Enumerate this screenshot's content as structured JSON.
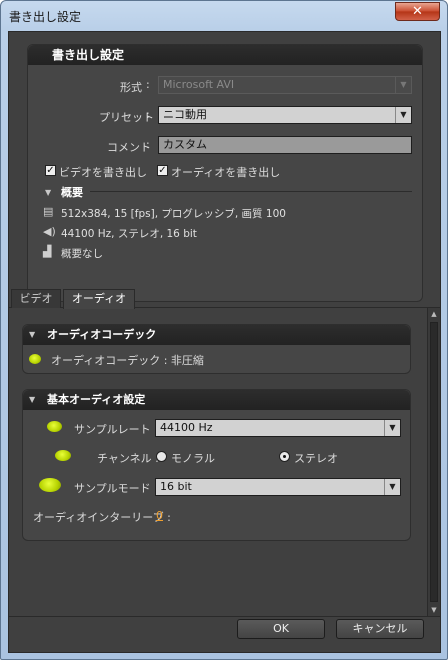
{
  "window": {
    "title": "書き出し設定",
    "close_glyph": "✕"
  },
  "export": {
    "section_title": "書き出し設定",
    "format_label": "形式",
    "format_value": "Microsoft AVI",
    "preset_label": "プリセット",
    "preset_value": "ニコ動用",
    "comment_label": "コメント",
    "comment_value": "カスタム",
    "export_video_label": "ビデオを書き出し",
    "export_audio_label": "オーディオを書き出し",
    "summary_title": "概要",
    "summary_video": "512x384, 15 [fps], プログレッシブ, 画質 100",
    "summary_audio": "44100 Hz, ステレオ, 16 bit",
    "summary_none": "概要なし"
  },
  "tabs": [
    {
      "label": "ビデオ"
    },
    {
      "label": "オーディオ"
    }
  ],
  "audio": {
    "codec_section_title": "オーディオコーデック",
    "codec_text": "オーディオコーデック : 非圧縮",
    "basic_section_title": "基本オーディオ設定",
    "sample_rate_label": "サンプルレート :",
    "sample_rate_value": "44100 Hz",
    "channels_label": "チャンネル :",
    "mono_label": "モノラル",
    "stereo_label": "ステレオ",
    "channel_selected": "ステレオ",
    "sample_mode_label": "サンプルモード :",
    "sample_mode_value": "16 bit",
    "interleave_label": "オーディオインターリーブ :",
    "interleave_value": "0"
  },
  "buttons": {
    "ok": "OK",
    "cancel": "キャンセル"
  },
  "colors": {
    "accent_link": "#f0a030",
    "panel_bg": "#464646",
    "client_bg": "#404040"
  }
}
